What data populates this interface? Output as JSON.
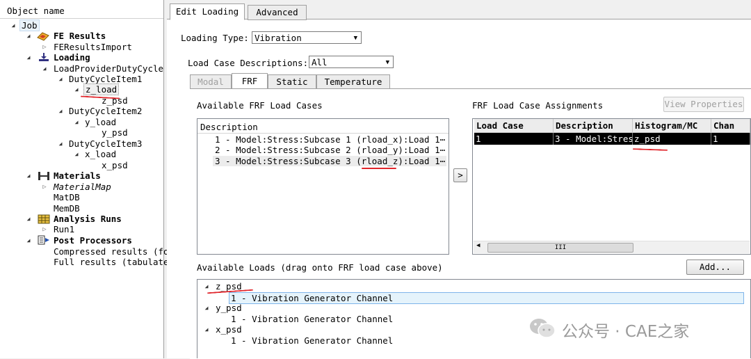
{
  "tree": {
    "header": "Object name",
    "nodes": {
      "job": "Job",
      "fe_results": "FE Results",
      "fe_results_import": "FEResultsImport",
      "loading": "Loading",
      "load_provider": "LoadProviderDutyCycle",
      "duty1": "DutyCycleItem1",
      "z_load": "z_load",
      "z_psd": "z_psd",
      "duty2": "DutyCycleItem2",
      "y_load": "y_load",
      "y_psd": "y_psd",
      "duty3": "DutyCycleItem3",
      "x_load": "x_load",
      "x_psd": "x_psd",
      "materials": "Materials",
      "material_map": "MaterialMap",
      "matdb": "MatDB",
      "memdb": "MemDB",
      "analysis_runs": "Analysis Runs",
      "run1": "Run1",
      "post_processors": "Post Processors",
      "compressed": "Compressed results (fo",
      "full": "Full results (tabulate"
    }
  },
  "main_tabs": [
    "Edit Loading",
    "Advanced"
  ],
  "loading_type": {
    "label": "Loading Type:",
    "value": "Vibration"
  },
  "load_case_desc": {
    "label": "Load Case Descriptions:",
    "value": "All"
  },
  "sub_tabs": [
    "Modal",
    "FRF",
    "Static",
    "Temperature"
  ],
  "available_frf": {
    "title": "Available FRF Load Cases",
    "column": "Description",
    "rows": [
      "1 - Model:Stress:Subcase 1 (rload_x):Load 1⋯",
      "2 - Model:Stress:Subcase 2 (rload_y):Load 1⋯",
      "3 - Model:Stress:Subcase 3 (rload_z):Load 1⋯"
    ]
  },
  "transfer_button": ">",
  "assignments": {
    "title": "FRF Load Case Assignments",
    "view_properties": "View Properties",
    "columns": [
      "Load Case",
      "Description",
      "Histogram/MC",
      "Chan"
    ],
    "rows": [
      [
        "1",
        "3 - Model:Stres",
        "z_psd",
        "1"
      ]
    ],
    "scroll_marker": "III"
  },
  "available_loads": {
    "title": "Available Loads (drag onto FRF load case above)",
    "add_button": "Add...",
    "groups": [
      {
        "name": "z_psd",
        "item": "1 - Vibration Generator Channel"
      },
      {
        "name": "y_psd",
        "item": "1 - Vibration Generator Channel"
      },
      {
        "name": "x_psd",
        "item": "1 - Vibration Generator Channel"
      }
    ]
  },
  "watermark": "公众号 · CAE之家",
  "colors": {
    "annotation": "#e0242a",
    "selection": "#000000"
  }
}
